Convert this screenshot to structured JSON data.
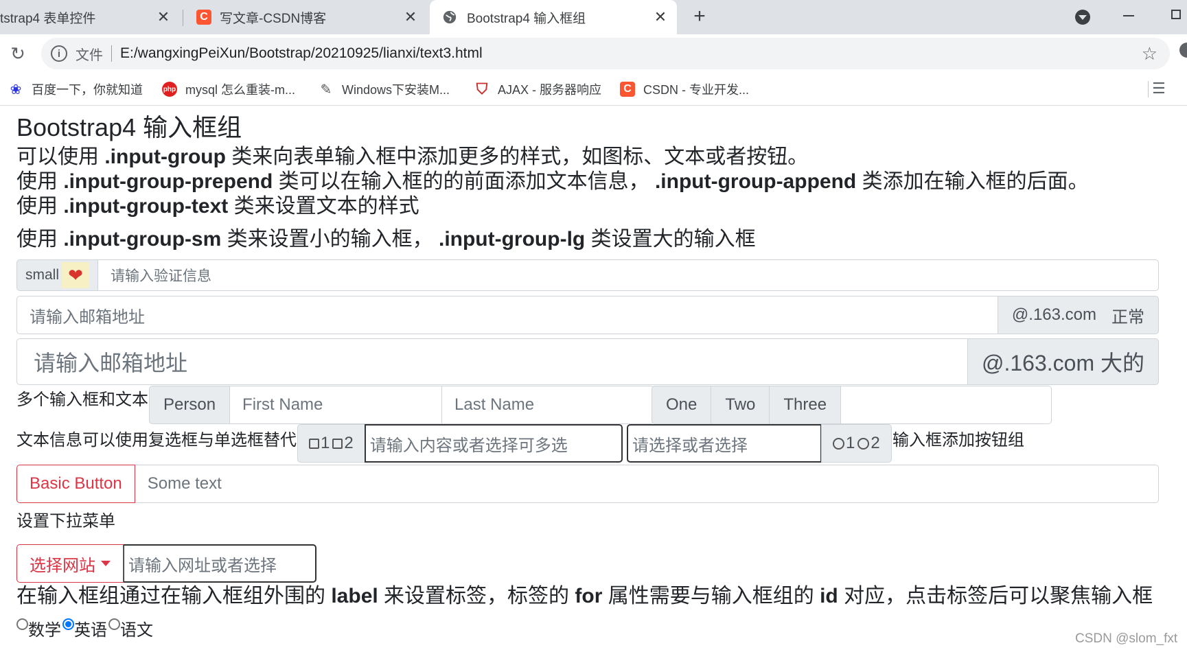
{
  "tabs": [
    {
      "label": "tstrap4 表单控件",
      "close": "✕"
    },
    {
      "label": "写文章-CSDN博客",
      "close": "✕",
      "favicon": "C"
    },
    {
      "label": "Bootstrap4 输入框组",
      "close": "✕"
    }
  ],
  "new_tab": "+",
  "address": {
    "reload": "↻",
    "info": "i",
    "file_label": "文件",
    "url": "E:/wangxingPeiXun/Bootstrap/20210925/lianxi/text3.html",
    "star": "☆"
  },
  "bookmarks": [
    {
      "label": "百度一下，你就知道",
      "icon": "paw-icon",
      "glyph": "❀",
      "color": "#2932e1"
    },
    {
      "label": "mysql 怎么重装-m...",
      "icon": "php-icon",
      "glyph": "php",
      "color": "#e02020"
    },
    {
      "label": "Windows下安装M...",
      "icon": "dolphin-icon",
      "glyph": "✎",
      "color": "#555555"
    },
    {
      "label": "AJAX - 服务器响应",
      "icon": "shield-icon",
      "glyph": "⛉",
      "color": "#c9302c"
    },
    {
      "label": "CSDN - 专业开发...",
      "icon": "csdn-icon",
      "glyph": "C",
      "color": "#fc5531"
    }
  ],
  "page": {
    "title": "Bootstrap4 输入框组",
    "desc1_a": "可以使用 ",
    "desc1_code": ".input-group",
    "desc1_b": " 类来向表单输入框中添加更多的样式，如图标、文本或者按钮。",
    "desc2_a": "使用 ",
    "desc2_code1": ".input-group-prepend",
    "desc2_b": " 类可以在输入框的的前面添加文本信息，",
    "desc2_code2": ".input-group-append",
    "desc2_c": " 类添加在输入框的后面。",
    "desc3_a": "使用 ",
    "desc3_code": ".input-group-text",
    "desc3_b": " 类来设置文本的样式",
    "desc4_a": "使用 ",
    "desc4_code1": ".input-group-sm",
    "desc4_b": " 类来设置小的输入框，",
    "desc4_code2": ".input-group-lg",
    "desc4_c": " 类设置大的输入框",
    "small": {
      "addon": "small",
      "placeholder": "请输入验证信息"
    },
    "normal": {
      "placeholder": "请输入邮箱地址",
      "addon": "@.163.com",
      "size_label": "正常"
    },
    "large": {
      "placeholder": "请输入邮箱地址",
      "addon": "@.163.com 大的"
    },
    "multi": {
      "label": "多个输入框和文本",
      "person": "Person",
      "first": "First Name",
      "last": "Last Name",
      "one": "One",
      "two": "Two",
      "three": "Three"
    },
    "check": {
      "label": "文本信息可以使用复选框与单选框替代",
      "cb1": "1",
      "cb2": "2",
      "placeholder1": "请输入内容或者选择可多选",
      "placeholder2": "请选择或者选择",
      "rb1": "1",
      "rb2": "2",
      "tail": "输入框添加按钮组"
    },
    "button": {
      "label": "Basic Button",
      "placeholder": "Some text"
    },
    "dropdown": {
      "heading": "设置下拉菜单",
      "button": "选择网站",
      "placeholder": "请输入网址或者选择"
    },
    "label_note_a": "在输入框组通过在输入框组外围的 ",
    "label_note_code1": "label",
    "label_note_b": " 来设置标签，标签的 ",
    "label_note_code2": "for",
    "label_note_c": " 属性需要与输入框组的 ",
    "label_note_code3": "id",
    "label_note_d": " 对应，点击标签后可以聚焦输入框",
    "radios": [
      {
        "label": "数学",
        "checked": false
      },
      {
        "label": "英语",
        "checked": true
      },
      {
        "label": "语文",
        "checked": false
      }
    ]
  },
  "watermark": "CSDN @slom_fxt"
}
